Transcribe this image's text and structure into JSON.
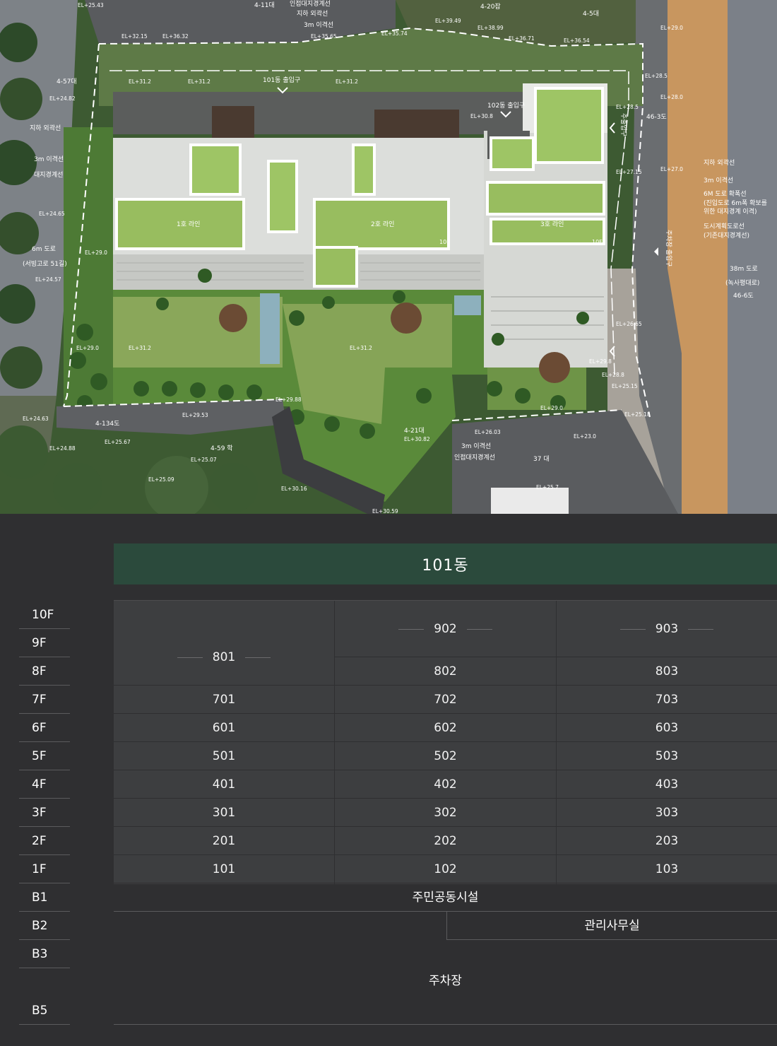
{
  "site_plan": {
    "labels": {
      "entrance_101": "101동 출입구",
      "entrance_102": "102동 출입구",
      "line1": "1호 라인",
      "line2": "2호 라인",
      "line3": "3호 라인",
      "floor_10f_a": "10F",
      "floor_10f_b": "10F",
      "adjacent_boundary": "인접대지경계선",
      "underground_line": "지하 외곽선",
      "setback_3m": "3m 이격선",
      "parking_entrance": "주차장 출입구",
      "main_entrance": "주출입구",
      "road_6m": "6m 도로",
      "road_6m_name": "(서빙고로 51길)",
      "road_38m": "38m 도로",
      "road_38m_name": "(녹사평대로)",
      "addr_46_6": "46-6도",
      "addr_46_3": "46-3도",
      "addr_4_11": "4-11대",
      "addr_4_20": "4-20잡",
      "addr_4_5": "4-5대",
      "addr_4_57": "4-57대",
      "addr_4_134": "4-134도",
      "addr_4_59": "4-59 학",
      "addr_4_21": "4-21대",
      "addr_37": "37 대",
      "left_underground": "지하 외곽선",
      "left_setback": "3m 이격선",
      "left_boundary": "대지경계선",
      "right_underground": "지하 외곽선",
      "right_setback": "3m 이격선",
      "right_road_expand_1": "6M 도로 확폭선",
      "right_road_expand_2": "(진입도로 6m폭 확보를",
      "right_road_expand_3": "위한 대지경계 이격)",
      "right_city_plan_1": "도시계획도로선",
      "right_city_plan_2": "(기존대지경계선)",
      "bottom_setback": "3m 이격선",
      "bottom_boundary": "인접대지경계선",
      "top_underground": "지하 외곽선",
      "top_setback": "3m 이격선"
    },
    "elevations": [
      "EL+25.43",
      "EL+32.15",
      "EL+36.32",
      "EL+35.65",
      "EL+35.74",
      "EL+39.49",
      "EL+38.99",
      "EL+36.71",
      "EL+36.54",
      "EL+29.0",
      "EL+31.2",
      "EL+31.2",
      "EL+31.2",
      "EL+30.8",
      "EL+28.5",
      "EL+28.0",
      "EL+28.5",
      "EL+27.0",
      "EL+27.15",
      "EL+24.82",
      "EL+24.65",
      "EL+29.0",
      "EL+24.57",
      "EL+29.0",
      "EL+31.2",
      "EL+31.2",
      "EL+26.65",
      "EL+29.8",
      "EL+28.8",
      "EL+25.15",
      "EL+25.18",
      "EL+24.63",
      "EL+25.67",
      "EL+29.53",
      "EL+29.88",
      "EL+25.07",
      "EL+25.09",
      "EL+24.88",
      "EL+30.82",
      "EL+26.03",
      "EL+23.0",
      "EL+30.16",
      "EL+30.59",
      "EL+25.7",
      "EL+29.0"
    ]
  },
  "building_title": "101동",
  "floors": [
    "10F",
    "9F",
    "8F",
    "7F",
    "6F",
    "5F",
    "4F",
    "3F",
    "2F",
    "1F",
    "B1",
    "B2",
    "B3",
    "B5"
  ],
  "units": {
    "col1": [
      "801",
      "701",
      "601",
      "501",
      "401",
      "301",
      "201",
      "101"
    ],
    "col2": [
      "902",
      "802",
      "702",
      "602",
      "502",
      "402",
      "302",
      "202",
      "102"
    ],
    "col3": [
      "903",
      "803",
      "703",
      "603",
      "503",
      "403",
      "303",
      "203",
      "103"
    ]
  },
  "basement": {
    "b1": "주민공동시설",
    "b2": "관리사무실",
    "parking": "주차장"
  }
}
